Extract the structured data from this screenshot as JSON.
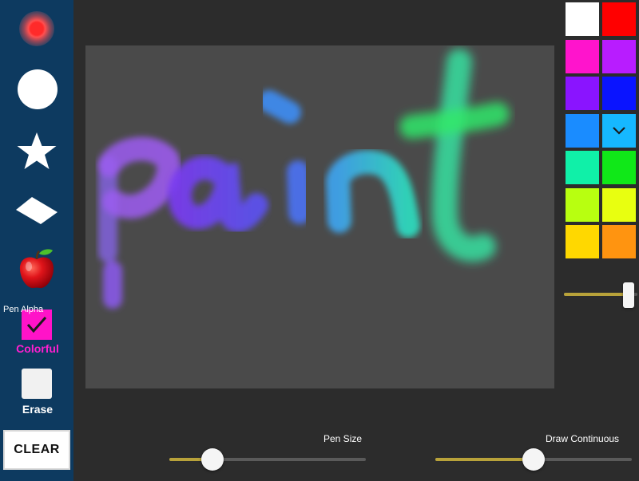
{
  "toolbar": {
    "tools": [
      {
        "name": "glow-brush",
        "icon": "glow-dot-icon",
        "color": "#ff2a2a"
      },
      {
        "name": "circle-brush",
        "icon": "circle-icon",
        "color": "#ffffff"
      },
      {
        "name": "star-brush",
        "icon": "star-icon",
        "color": "#ffffff"
      },
      {
        "name": "diamond-brush",
        "icon": "diamond-icon",
        "color": "#ffffff"
      },
      {
        "name": "apple-brush",
        "icon": "apple-icon",
        "color": "#e3191a"
      }
    ],
    "colorful_label": "Colorful",
    "colorful_checked": true,
    "erase_label": "Erase",
    "erase_checked": false,
    "clear_label": "CLEAR"
  },
  "canvas": {
    "drawing_text": "paint"
  },
  "palette": {
    "colors": [
      "#ffffff",
      "#ff0000",
      "#ff14cc",
      "#b81cff",
      "#8a14ff",
      "#0a14ff",
      "#1a8cff",
      "#16b8ff",
      "#10f0a8",
      "#10e818",
      "#b8ff10",
      "#e8ff10",
      "#ffd800",
      "#ff9410"
    ],
    "selected_index": 7
  },
  "controls": {
    "pen_alpha": {
      "label": "Pen Alpha",
      "value": 0.9
    },
    "pen_size": {
      "label": "Pen Size",
      "value": 0.22
    },
    "draw_continuous": {
      "label": "Draw Continuous",
      "value": 0.5
    }
  }
}
